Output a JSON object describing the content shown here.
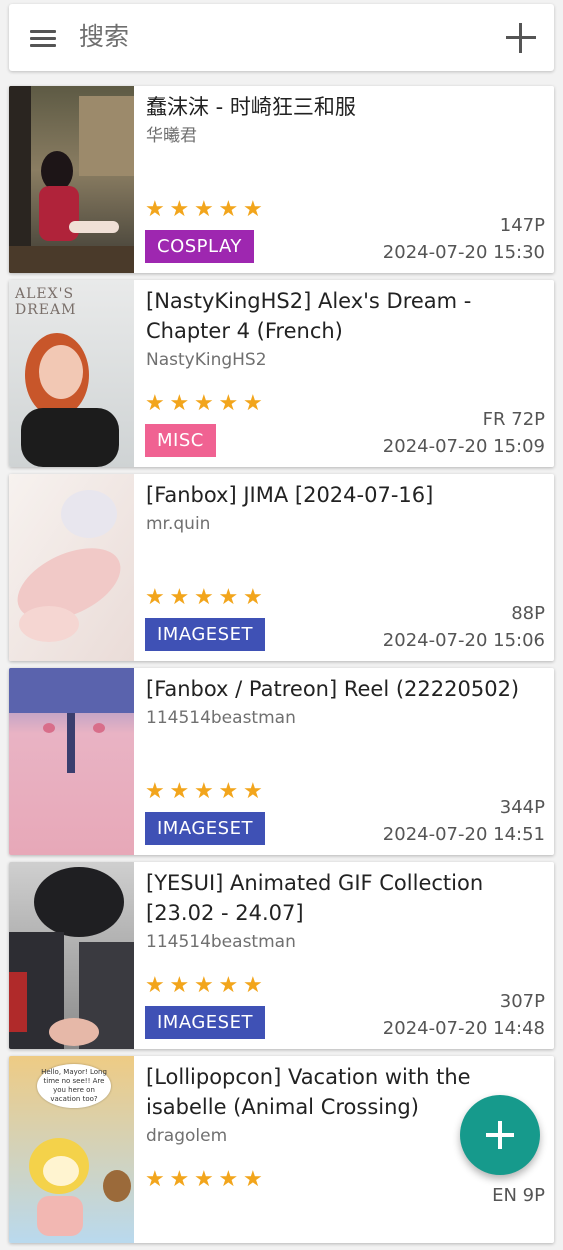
{
  "search": {
    "placeholder": "搜索"
  },
  "icons": {
    "menu": "menu-icon",
    "add": "add-icon",
    "star": "star-icon",
    "fab": "add-icon"
  },
  "colors": {
    "star": "#f2a51c",
    "fab": "#169a8c",
    "cosplay": "#9e27b0",
    "misc": "#f06292",
    "imageset": "#3f51b5"
  },
  "galleries": [
    {
      "title": "蠢沫沫 - 时崎狂三和服",
      "uploader": "华曦君",
      "rating": 5,
      "category": "COSPLAY",
      "category_color": "#9e27b0",
      "pages": "147P",
      "posted": "2024-07-20 15:30",
      "thumb_label": ""
    },
    {
      "title": "[NastyKingHS2] Alex's Dream - Chapter 4 (French)",
      "uploader": "NastyKingHS2",
      "rating": 5,
      "category": "MISC",
      "category_color": "#f06292",
      "pages": "FR 72P",
      "posted": "2024-07-20 15:09",
      "thumb_label": "ALEX'S DREAM"
    },
    {
      "title": "[Fanbox] JIMA [2024-07-16]",
      "uploader": "mr.quin",
      "rating": 5,
      "category": "IMAGESET",
      "category_color": "#3f51b5",
      "pages": "88P",
      "posted": "2024-07-20 15:06",
      "thumb_label": ""
    },
    {
      "title": "[Fanbox / Patreon] Reel (22220502)",
      "uploader": "114514beastman",
      "rating": 5,
      "category": "IMAGESET",
      "category_color": "#3f51b5",
      "pages": "344P",
      "posted": "2024-07-20 14:51",
      "thumb_label": ""
    },
    {
      "title": "[YESUI] Animated GIF Collection [23.02 - 24.07]",
      "uploader": "114514beastman",
      "rating": 5,
      "category": "IMAGESET",
      "category_color": "#3f51b5",
      "pages": "307P",
      "posted": "2024-07-20 14:48",
      "thumb_label": ""
    },
    {
      "title": "[Lollipopcon] Vacation with the isabelle (Animal Crossing)",
      "uploader": "dragolem",
      "rating": 5,
      "category": "",
      "category_color": "#3f51b5",
      "pages": "EN 9P",
      "posted": "",
      "thumb_label": "Hello, Mayor! Long time no see!! Are you here on vacation too?"
    }
  ]
}
